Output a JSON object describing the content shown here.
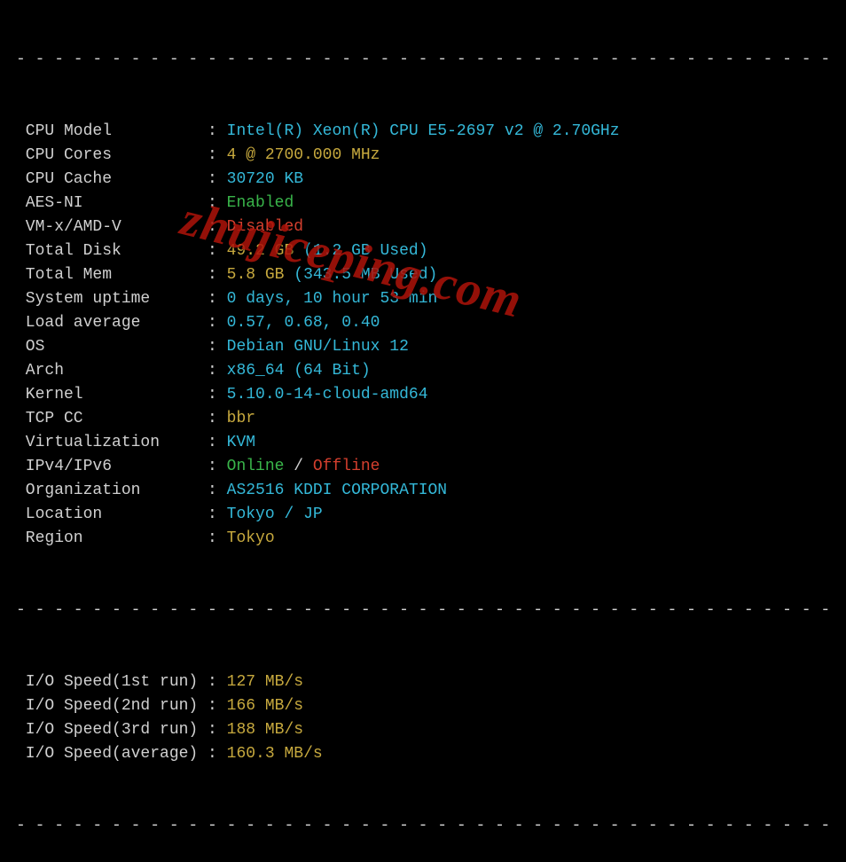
{
  "dash": "- - - - - - - - - - - - - - - - - - - - - - - - - - - - - - - - - - - - - - - - - - - - - - -",
  "sys": [
    {
      "label": "CPU Model          ",
      "parts": [
        {
          "cls": "cyan",
          "t": "Intel(R) Xeon(R) CPU E5-2697 v2 @ 2.70GHz"
        }
      ]
    },
    {
      "label": "CPU Cores          ",
      "parts": [
        {
          "cls": "yellow",
          "t": "4 @ 2700.000 MHz"
        }
      ]
    },
    {
      "label": "CPU Cache          ",
      "parts": [
        {
          "cls": "cyan",
          "t": "30720 KB"
        }
      ]
    },
    {
      "label": "AES-NI             ",
      "parts": [
        {
          "cls": "green",
          "t": "Enabled"
        }
      ]
    },
    {
      "label": "VM-x/AMD-V         ",
      "parts": [
        {
          "cls": "red",
          "t": "Disabled"
        }
      ]
    },
    {
      "label": "Total Disk         ",
      "parts": [
        {
          "cls": "yellow",
          "t": "49.2 GB "
        },
        {
          "cls": "cyan",
          "t": "(1.2 GB Used)"
        }
      ]
    },
    {
      "label": "Total Mem          ",
      "parts": [
        {
          "cls": "yellow",
          "t": "5.8 GB "
        },
        {
          "cls": "cyan",
          "t": "(343.5 MB Used)"
        }
      ]
    },
    {
      "label": "System uptime      ",
      "parts": [
        {
          "cls": "cyan",
          "t": "0 days, 10 hour 53 min"
        }
      ]
    },
    {
      "label": "Load average       ",
      "parts": [
        {
          "cls": "cyan",
          "t": "0.57, 0.68, 0.40"
        }
      ]
    },
    {
      "label": "OS                 ",
      "parts": [
        {
          "cls": "cyan",
          "t": "Debian GNU/Linux 12"
        }
      ]
    },
    {
      "label": "Arch               ",
      "parts": [
        {
          "cls": "cyan",
          "t": "x86_64 (64 Bit)"
        }
      ]
    },
    {
      "label": "Kernel             ",
      "parts": [
        {
          "cls": "cyan",
          "t": "5.10.0-14-cloud-amd64"
        }
      ]
    },
    {
      "label": "TCP CC             ",
      "parts": [
        {
          "cls": "yellow",
          "t": "bbr"
        }
      ]
    },
    {
      "label": "Virtualization     ",
      "parts": [
        {
          "cls": "cyan",
          "t": "KVM"
        }
      ]
    },
    {
      "label": "IPv4/IPv6          ",
      "parts": [
        {
          "cls": "green",
          "t": "Online"
        },
        {
          "cls": "white",
          "t": " / "
        },
        {
          "cls": "red",
          "t": "Offline"
        }
      ]
    },
    {
      "label": "Organization       ",
      "parts": [
        {
          "cls": "cyan",
          "t": "AS2516 KDDI CORPORATION"
        }
      ]
    },
    {
      "label": "Location           ",
      "parts": [
        {
          "cls": "cyan",
          "t": "Tokyo / JP"
        }
      ]
    },
    {
      "label": "Region             ",
      "parts": [
        {
          "cls": "yellow",
          "t": "Tokyo"
        }
      ]
    }
  ],
  "io": [
    {
      "label": "I/O Speed(1st run) ",
      "parts": [
        {
          "cls": "yellow",
          "t": "127 MB/s"
        }
      ]
    },
    {
      "label": "I/O Speed(2nd run) ",
      "parts": [
        {
          "cls": "yellow",
          "t": "166 MB/s"
        }
      ]
    },
    {
      "label": "I/O Speed(3rd run) ",
      "parts": [
        {
          "cls": "yellow",
          "t": "188 MB/s"
        }
      ]
    },
    {
      "label": "I/O Speed(average) ",
      "parts": [
        {
          "cls": "yellow",
          "t": "160.3 MB/s"
        }
      ]
    }
  ],
  "watermark": "zhujiceping.com"
}
